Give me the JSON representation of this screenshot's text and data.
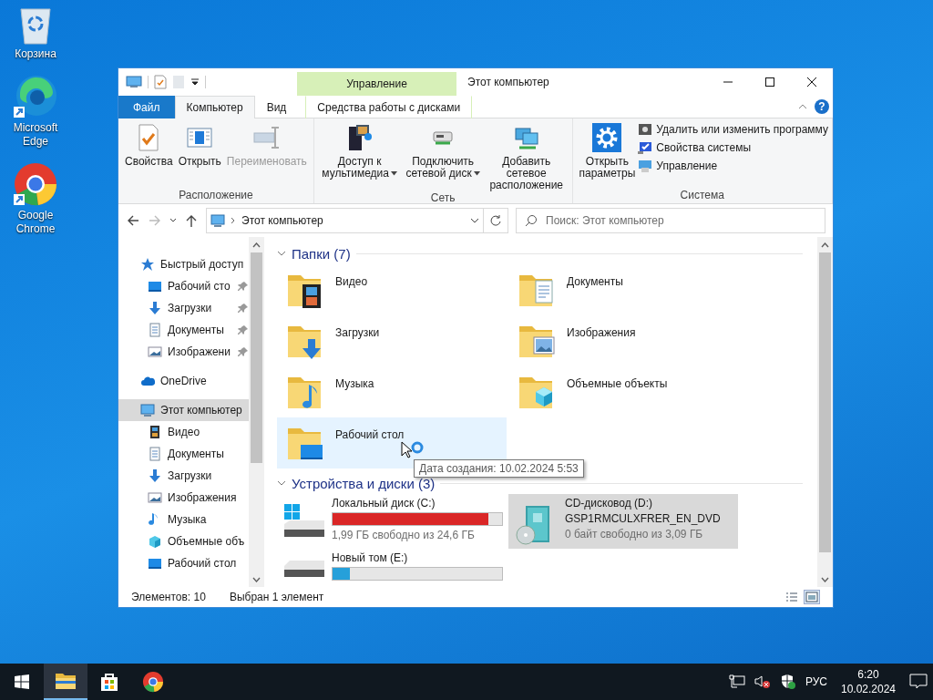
{
  "desktop_icons": [
    {
      "label": "Корзина",
      "kind": "recycle"
    },
    {
      "label": "Microsoft Edge",
      "kind": "edge"
    },
    {
      "label": "Google Chrome",
      "kind": "chrome"
    }
  ],
  "window": {
    "title": "Этот компьютер",
    "context_group": "Управление",
    "help": "?"
  },
  "ribbon_tabs": [
    {
      "label": "Файл",
      "kind": "file",
      "selected": false
    },
    {
      "label": "Компьютер",
      "kind": "normal",
      "selected": true
    },
    {
      "label": "Вид",
      "kind": "normal",
      "selected": false
    },
    {
      "label": "Средства работы с дисками",
      "kind": "context",
      "selected": false
    }
  ],
  "ribbon_groups": [
    {
      "name": "Расположение",
      "buttons": [
        {
          "label": "Свойства",
          "kind": "properties",
          "disabled": false,
          "dropdown": false
        },
        {
          "label": "Открыть",
          "kind": "open",
          "disabled": false,
          "dropdown": false
        },
        {
          "label": "Переименовать",
          "kind": "rename",
          "disabled": true,
          "dropdown": false
        }
      ]
    },
    {
      "name": "Сеть",
      "buttons": [
        {
          "label": "Доступ к мультимедиа",
          "kind": "media",
          "disabled": false,
          "dropdown": true
        },
        {
          "label": "Подключить сетевой диск",
          "kind": "netdrive",
          "disabled": false,
          "dropdown": true
        },
        {
          "label": "Добавить сетевое расположение",
          "kind": "netplace",
          "disabled": false,
          "dropdown": false
        }
      ]
    },
    {
      "name": "Система",
      "buttons": [
        {
          "label": "Открыть параметры",
          "kind": "settings",
          "disabled": false,
          "dropdown": false
        }
      ],
      "small_buttons": [
        {
          "label": "Удалить или изменить программу",
          "kind": "programs"
        },
        {
          "label": "Свойства системы",
          "kind": "sysprops"
        },
        {
          "label": "Управление",
          "kind": "manage"
        }
      ]
    }
  ],
  "address": {
    "path": "Этот компьютер"
  },
  "search": {
    "placeholder": "Поиск: Этот компьютер"
  },
  "navigation": [
    {
      "label": "Быстрый доступ",
      "kind": "star",
      "selected": false,
      "children": [
        {
          "label": "Рабочий сто",
          "kind": "desktop",
          "pinned": true,
          "selected": false
        },
        {
          "label": "Загрузки",
          "kind": "downloads",
          "pinned": true,
          "selected": false
        },
        {
          "label": "Документы",
          "kind": "documents",
          "pinned": true,
          "selected": false
        },
        {
          "label": "Изображени",
          "kind": "pictures",
          "pinned": true,
          "selected": false
        }
      ]
    },
    {
      "label": "OneDrive",
      "kind": "cloud",
      "selected": false
    },
    {
      "label": "Этот компьютер",
      "kind": "pc",
      "selected": true,
      "children": [
        {
          "label": "Видео",
          "kind": "video",
          "pinned": false,
          "selected": false
        },
        {
          "label": "Документы",
          "kind": "documents",
          "pinned": false,
          "selected": false
        },
        {
          "label": "Загрузки",
          "kind": "downloads",
          "pinned": false,
          "selected": false
        },
        {
          "label": "Изображения",
          "kind": "pictures",
          "pinned": false,
          "selected": false
        },
        {
          "label": "Музыка",
          "kind": "music",
          "pinned": false,
          "selected": false
        },
        {
          "label": "Объемные объ",
          "kind": "objects3d",
          "pinned": false,
          "selected": false
        },
        {
          "label": "Рабочий стол",
          "kind": "desktop",
          "pinned": false,
          "selected": false
        }
      ]
    }
  ],
  "folders_section": {
    "title": "Папки (7)"
  },
  "folders": [
    {
      "name": "Видео",
      "kind": "video",
      "selected": false
    },
    {
      "name": "Документы",
      "kind": "documents",
      "selected": false
    },
    {
      "name": "Загрузки",
      "kind": "downloads",
      "selected": false
    },
    {
      "name": "Изображения",
      "kind": "pictures",
      "selected": false
    },
    {
      "name": "Музыка",
      "kind": "music",
      "selected": false
    },
    {
      "name": "Объемные объекты",
      "kind": "objects3d",
      "selected": false
    },
    {
      "name": "Рабочий стол",
      "kind": "desktop",
      "selected": true
    }
  ],
  "tooltip": "Дата создания: 10.02.2024 5:53",
  "drives_section": {
    "title": "Устройства и диски (3)"
  },
  "drives": [
    {
      "name": "Локальный диск (C:)",
      "kind": "system",
      "level": 0.92,
      "free": "1,99 ГБ свободно из 24,6 ГБ",
      "selected": false
    },
    {
      "name": "CD-дисковод (D:)",
      "kind": "cd",
      "label": "GSP1RMCULXFRER_EN_DVD",
      "free": "0 байт свободно из 3,09 ГБ",
      "selected": true
    },
    {
      "name": "Новый том (E:)",
      "kind": "hdd",
      "level": 0.1,
      "selected": false
    }
  ],
  "status_bar": {
    "count": "Элементов: 10",
    "selection": "Выбран 1 элемент",
    "views": [
      {
        "kind": "details",
        "selected": false
      },
      {
        "kind": "tiles",
        "selected": true
      }
    ]
  },
  "taskbar": {
    "apps": [
      {
        "kind": "explorer",
        "active": true
      },
      {
        "kind": "store",
        "active": false
      },
      {
        "kind": "chrome",
        "active": false
      }
    ],
    "language": "РУС",
    "time": "6:20",
    "date": "10.02.2024"
  }
}
